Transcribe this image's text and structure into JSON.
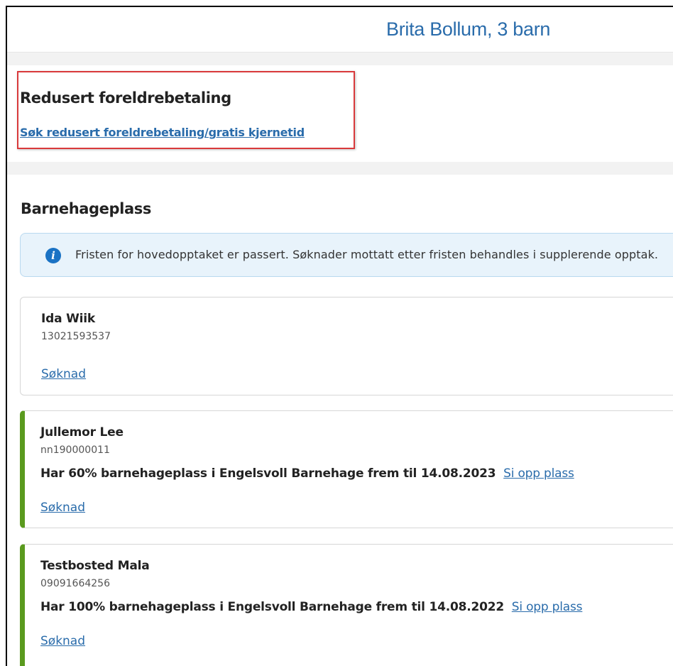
{
  "header": {
    "title": "Brita Bollum, 3 barn"
  },
  "reduced_payment": {
    "title": "Redusert foreldrebetaling",
    "link": "Søk redusert foreldrebetaling/gratis kjernetid"
  },
  "kindergarten": {
    "title": "Barnehageplass",
    "info_icon": "info-icon",
    "info_text": "Fristen for hovedopptaket er passert. Søknader mottatt etter fristen behandles i supplerende opptak."
  },
  "children": [
    {
      "name": "Ida Wiik",
      "id": "13021593537",
      "application_link": "Søknad"
    },
    {
      "name": "Jullemor Lee",
      "id": "nn190000011",
      "placement": "Har 60% barnehageplass i Engelsvoll Barnehage frem til 14.08.2023",
      "terminate_link": "Si opp plass",
      "application_link": "Søknad"
    },
    {
      "name": "Testbosted Mala",
      "id": "09091664256",
      "placement": "Har 100% barnehageplass i Engelsvoll Barnehage frem til 14.08.2022",
      "terminate_link": "Si opp plass",
      "application_link": "Søknad"
    }
  ],
  "colors": {
    "accent": "#2a6cab",
    "active_border": "#5a9a1e",
    "highlight": "#d9393b",
    "info_bg": "#e8f3fb"
  }
}
